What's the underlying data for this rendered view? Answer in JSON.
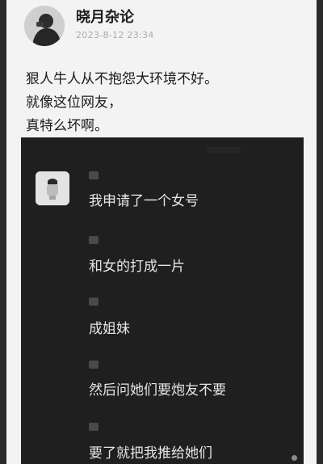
{
  "post": {
    "author": "晓月杂论",
    "timestamp": "2023-8-12 23:34",
    "lines": [
      "狠人牛人从不抱怨大环境不好。",
      "就像这位网友，",
      "真特么坏啊。"
    ]
  },
  "screenshot": {
    "messages": [
      "我申请了一个女号",
      "和女的打成一片",
      "成姐妹",
      "然后问她们要炮友不要",
      "要了就把我推给她们"
    ]
  },
  "icons": {
    "author_avatar": "avatar-photo",
    "chat_avatar": "avatar-thumbnail"
  }
}
